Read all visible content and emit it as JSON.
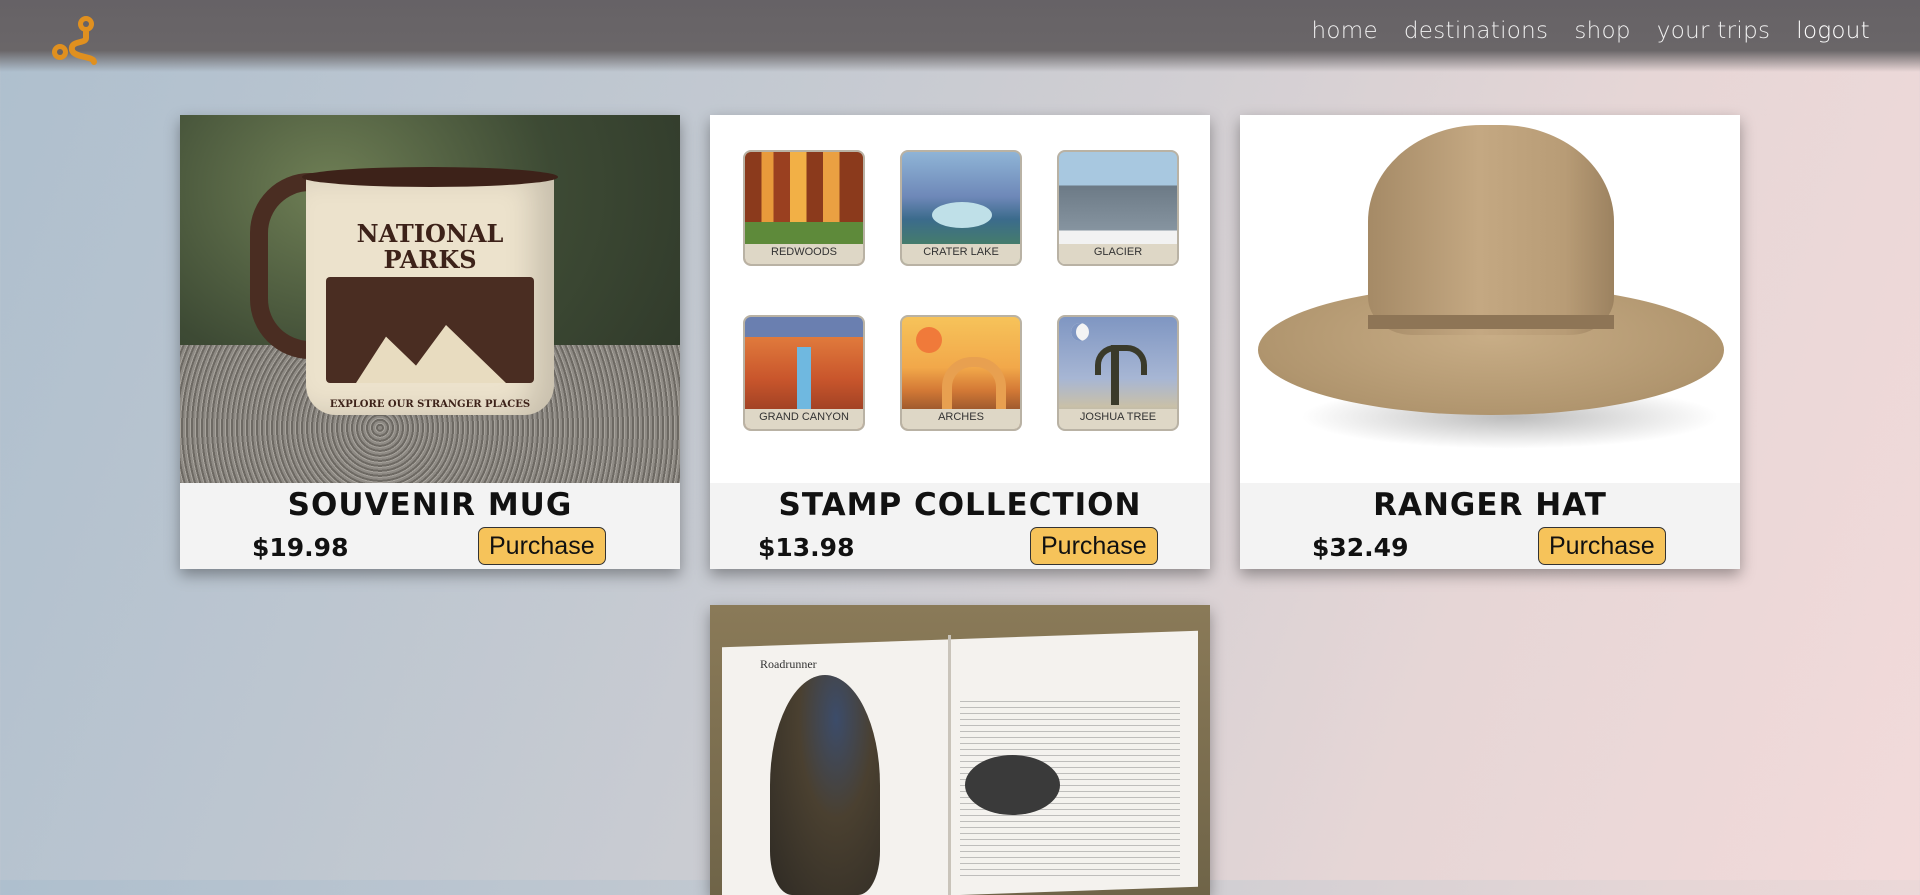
{
  "nav": {
    "items": [
      {
        "label": "home"
      },
      {
        "label": "destinations"
      },
      {
        "label": "shop"
      },
      {
        "label": "your trips"
      },
      {
        "label": "logout"
      }
    ],
    "logo_icon": "route-pin-icon",
    "logo_color": "#e0901f"
  },
  "products": [
    {
      "name": "SOUVENIR MUG",
      "price": "$19.98",
      "button": "Purchase",
      "mug_text": {
        "line1": "NATIONAL",
        "line2": "PARKS",
        "tagline": "EXPLORE OUR STRANGER PLACES"
      }
    },
    {
      "name": "STAMP COLLECTION",
      "price": "$13.98",
      "button": "Purchase",
      "stamps": [
        "REDWOODS",
        "CRATER LAKE",
        "GLACIER",
        "GRAND CANYON",
        "ARCHES",
        "JOSHUA TREE"
      ]
    },
    {
      "name": "RANGER HAT",
      "price": "$32.49",
      "button": "Purchase"
    },
    {
      "book_heading": "Roadrunner"
    }
  ],
  "colors": {
    "button_bg": "#f6c35a",
    "nav_bg": "#666266"
  }
}
